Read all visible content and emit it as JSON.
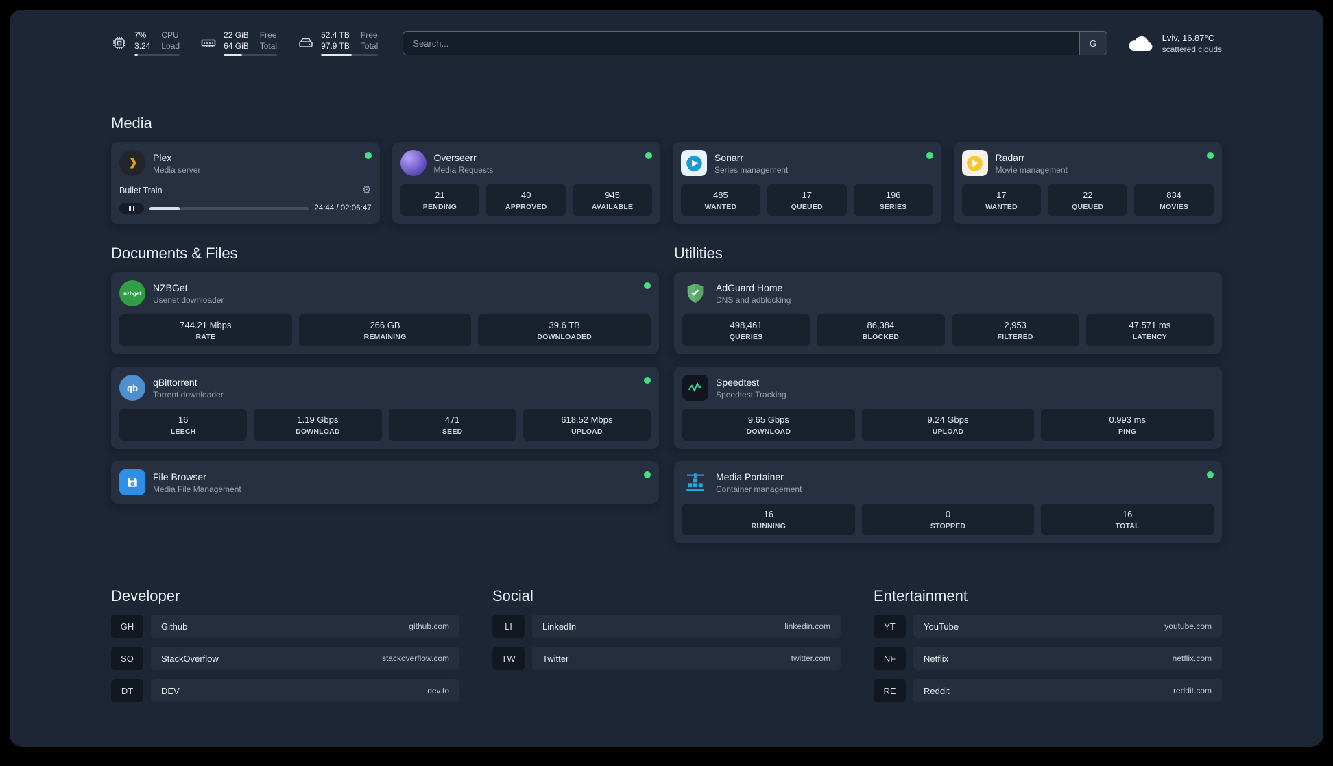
{
  "topbar": {
    "cpu": {
      "line1": "7%",
      "line2": "3.24",
      "label1": "CPU",
      "label2": "Load",
      "bar": "width:7%"
    },
    "memory": {
      "line1": "22 GiB",
      "line2": "64 GiB",
      "label1": "Free",
      "label2": "Total",
      "bar": "width:34%"
    },
    "disk": {
      "line1": "52.4 TB",
      "line2": "97.9 TB",
      "label1": "Free",
      "label2": "Total",
      "bar": "width:54%"
    },
    "search": {
      "placeholder": "Search...",
      "button": "G"
    },
    "weather": {
      "location": "Lviv, 16.87°C",
      "condition": "scattered clouds"
    }
  },
  "icons": {
    "gear": "⚙"
  },
  "colors": {
    "status_green": "#4ade80",
    "plex_orange": "#e5a00d",
    "radarr_yellow": "#f8c630",
    "sonarr_blue": "#1b9ad2",
    "adguard_green": "#67b279",
    "portainer_blue": "#1fa9e4"
  },
  "media": {
    "title": "Media",
    "cards": [
      {
        "title": "Plex",
        "subtitle": "Media server",
        "player": {
          "track": "Bullet Train",
          "time": "24:44 / 02:06:47",
          "progress": "width:19%"
        }
      },
      {
        "title": "Overseerr",
        "subtitle": "Media Requests",
        "stats": [
          {
            "value": "21",
            "label": "PENDING"
          },
          {
            "value": "40",
            "label": "APPROVED"
          },
          {
            "value": "945",
            "label": "AVAILABLE"
          }
        ]
      },
      {
        "title": "Sonarr",
        "subtitle": "Series management",
        "stats": [
          {
            "value": "485",
            "label": "WANTED"
          },
          {
            "value": "17",
            "label": "QUEUED"
          },
          {
            "value": "196",
            "label": "SERIES"
          }
        ]
      },
      {
        "title": "Radarr",
        "subtitle": "Movie management",
        "stats": [
          {
            "value": "17",
            "label": "WANTED"
          },
          {
            "value": "22",
            "label": "QUEUED"
          },
          {
            "value": "834",
            "label": "MOVIES"
          }
        ]
      }
    ]
  },
  "documents": {
    "title": "Documents & Files",
    "cards": [
      {
        "title": "NZBGet",
        "subtitle": "Usenet downloader",
        "icon_text": "nzbget",
        "stats": [
          {
            "value": "744.21 Mbps",
            "label": "RATE"
          },
          {
            "value": "266 GB",
            "label": "REMAINING"
          },
          {
            "value": "39.6 TB",
            "label": "DOWNLOADED"
          }
        ]
      },
      {
        "title": "qBittorrent",
        "subtitle": "Torrent downloader",
        "icon_text": "qb",
        "stats": [
          {
            "value": "16",
            "label": "LEECH"
          },
          {
            "value": "1.19 Gbps",
            "label": "DOWNLOAD"
          },
          {
            "value": "471",
            "label": "SEED"
          },
          {
            "value": "618.52 Mbps",
            "label": "UPLOAD"
          }
        ]
      },
      {
        "title": "File Browser",
        "subtitle": "Media File Management"
      }
    ]
  },
  "utilities": {
    "title": "Utilities",
    "cards": [
      {
        "title": "AdGuard Home",
        "subtitle": "DNS and adblocking",
        "stats": [
          {
            "value": "498,461",
            "label": "QUERIES"
          },
          {
            "value": "86,384",
            "label": "BLOCKED"
          },
          {
            "value": "2,953",
            "label": "FILTERED"
          },
          {
            "value": "47.571 ms",
            "label": "LATENCY"
          }
        ]
      },
      {
        "title": "Speedtest",
        "subtitle": "Speedtest Tracking",
        "stats": [
          {
            "value": "9.65 Gbps",
            "label": "DOWNLOAD"
          },
          {
            "value": "9.24 Gbps",
            "label": "UPLOAD"
          },
          {
            "value": "0.993 ms",
            "label": "PING"
          }
        ]
      },
      {
        "title": "Media Portainer",
        "subtitle": "Container management",
        "stats": [
          {
            "value": "16",
            "label": "RUNNING"
          },
          {
            "value": "0",
            "label": "STOPPED"
          },
          {
            "value": "16",
            "label": "TOTAL"
          }
        ]
      }
    ]
  },
  "bookmarks": [
    {
      "title": "Developer",
      "items": [
        {
          "abbr": "GH",
          "name": "Github",
          "url": "github.com"
        },
        {
          "abbr": "SO",
          "name": "StackOverflow",
          "url": "stackoverflow.com"
        },
        {
          "abbr": "DT",
          "name": "DEV",
          "url": "dev.to"
        }
      ]
    },
    {
      "title": "Social",
      "items": [
        {
          "abbr": "LI",
          "name": "LinkedIn",
          "url": "linkedin.com"
        },
        {
          "abbr": "TW",
          "name": "Twitter",
          "url": "twitter.com"
        }
      ]
    },
    {
      "title": "Entertainment",
      "items": [
        {
          "abbr": "YT",
          "name": "YouTube",
          "url": "youtube.com"
        },
        {
          "abbr": "NF",
          "name": "Netflix",
          "url": "netflix.com"
        },
        {
          "abbr": "RE",
          "name": "Reddit",
          "url": "reddit.com"
        }
      ]
    }
  ]
}
